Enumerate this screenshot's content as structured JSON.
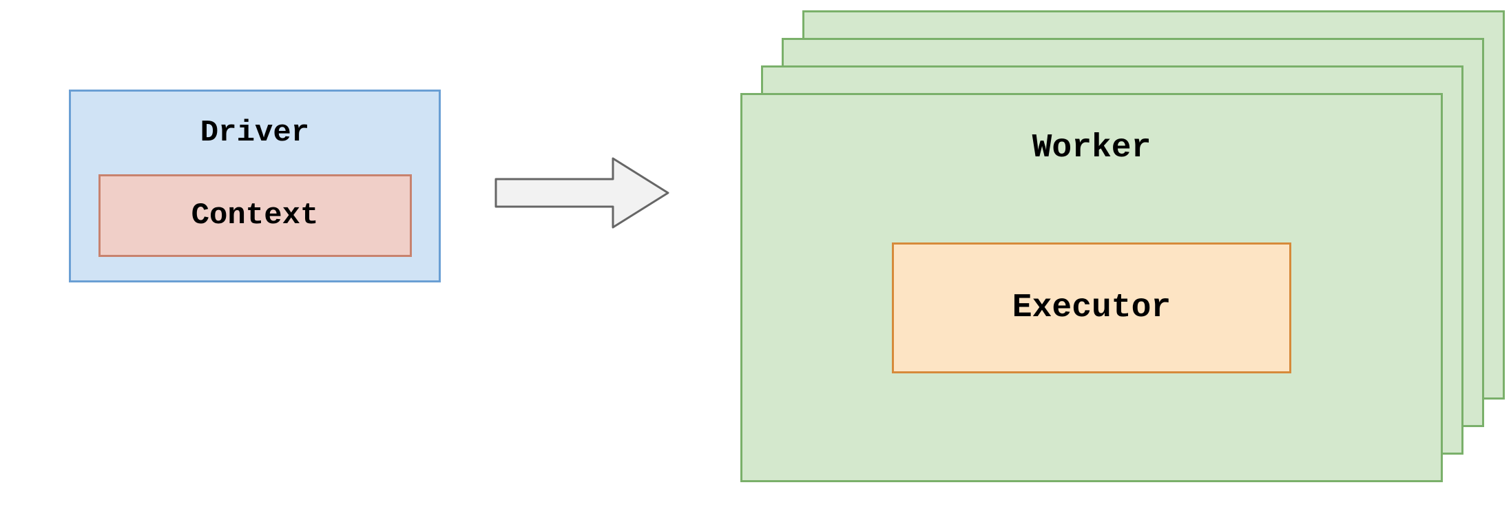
{
  "driver": {
    "label": "Driver",
    "context_label": "Context",
    "fill_color": "#d0e3f5",
    "border_color": "#6a9fd4",
    "context_fill": "#f0cfc8",
    "context_border": "#c8826e"
  },
  "worker": {
    "label": "Worker",
    "executor_label": "Executor",
    "count": 4,
    "fill_color": "#d4e8cd",
    "border_color": "#7ab06a",
    "executor_fill": "#fde4c4",
    "executor_border": "#d68a3a"
  },
  "arrow": {
    "direction": "right",
    "fill_color": "#f2f2f2",
    "border_color": "#666666"
  }
}
